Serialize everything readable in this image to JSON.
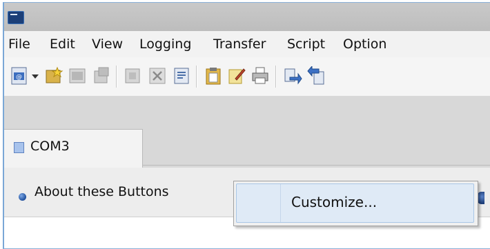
{
  "menubar": {
    "items": [
      "File",
      "Edit",
      "View",
      "Logging",
      "Transfer",
      "Script",
      "Option"
    ]
  },
  "toolbar": {
    "icons": [
      "connect-icon",
      "dropdown-arrow-icon",
      "quick-connect-icon",
      "disconnect-icon",
      "reconnect-icon",
      "close-session-icon",
      "properties-icon",
      "paste-icon",
      "edit-icon",
      "print-icon",
      "send-file-icon",
      "receive-file-icon"
    ]
  },
  "tabs": [
    {
      "label": "COM3"
    }
  ],
  "buttonbar": {
    "about_label": "About these Buttons"
  },
  "context_menu": {
    "items": [
      {
        "label": "Customize..."
      }
    ]
  },
  "colors": {
    "title_bar": "#c4c4c4",
    "menu_highlight": "#dfeaf6",
    "menu_highlight_border": "#a9c6e6",
    "accent_blue": "#1f4f9c"
  }
}
